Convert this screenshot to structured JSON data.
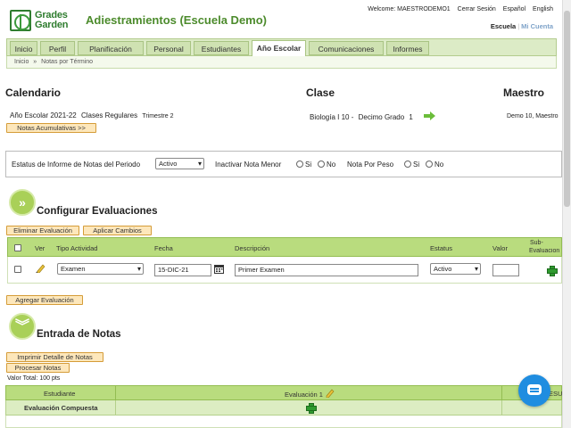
{
  "header": {
    "logo_line1": "Grades",
    "logo_line2": "Garden",
    "title": "Adiestramientos (Escuela Demo)",
    "welcome": "Welcome: MAESTRODEMO1",
    "logout": "Cerrar Sesión",
    "lang_es": "Español",
    "lang_en": "English",
    "scope_school": "Escuela",
    "scope_sep": "|",
    "scope_account": "Mi Cuenta"
  },
  "nav": {
    "tabs": [
      {
        "label": "Inicio"
      },
      {
        "label": "Perfil"
      },
      {
        "label": "Planificación"
      },
      {
        "label": "Personal"
      },
      {
        "label": "Estudiantes"
      },
      {
        "label": "Año Escolar"
      },
      {
        "label": "Comunicaciones"
      },
      {
        "label": "Informes"
      }
    ],
    "active_tab": "Año Escolar"
  },
  "breadcrumb": {
    "home": "Inicio",
    "separator": "»",
    "current": "Notas por Término"
  },
  "calendario": {
    "heading": "Calendario",
    "school_year": "Año Escolar 2021-22",
    "class_type": "Clases Regulares",
    "term": "Trimestre 2",
    "cumulative_button": "Notas Acumulativas >>"
  },
  "clase": {
    "heading": "Clase",
    "name": "Biología I 10 -",
    "grade": "Decimo Grado",
    "section": "1"
  },
  "maestro": {
    "heading": "Maestro",
    "name": "Demo 10, Maestro"
  },
  "status_bar": {
    "report_label": "Estatus de Informe de Notas del Periodo",
    "report_value": "Activo",
    "inactivate_label": "Inactivar Nota Menor",
    "yes": "Si",
    "no": "No",
    "weight_label": "Nota Por Peso"
  },
  "configurar": {
    "heading": "Configurar Evaluaciones",
    "delete_button": "Eliminar Evaluación",
    "apply_button": "Aplicar Cambios",
    "add_button": "Agregar Evaluación",
    "columns": {
      "ver": "Ver",
      "tipo": "Tipo Actividad",
      "fecha": "Fecha",
      "descripcion": "Descripción",
      "estatus": "Estatus",
      "valor": "Valor",
      "sub_line1": "Sub-",
      "sub_line2": "Evaluacion"
    },
    "rows": [
      {
        "tipo": "Examen",
        "fecha": "15-DIC-21",
        "descripcion": "Primer Examen",
        "estatus": "Activo",
        "valor": ""
      }
    ]
  },
  "entrada": {
    "heading": "Entrada de Notas",
    "print_button": "Imprimir Detalle de Notas",
    "process_button": "Procesar Notas",
    "total_label": "Valor Total:",
    "total_value": "100 pts",
    "col_student": "Estudiante",
    "col_eval": "Evaluación 1",
    "col_result": "ESU",
    "row_composite": "Evaluación Compuesta"
  }
}
